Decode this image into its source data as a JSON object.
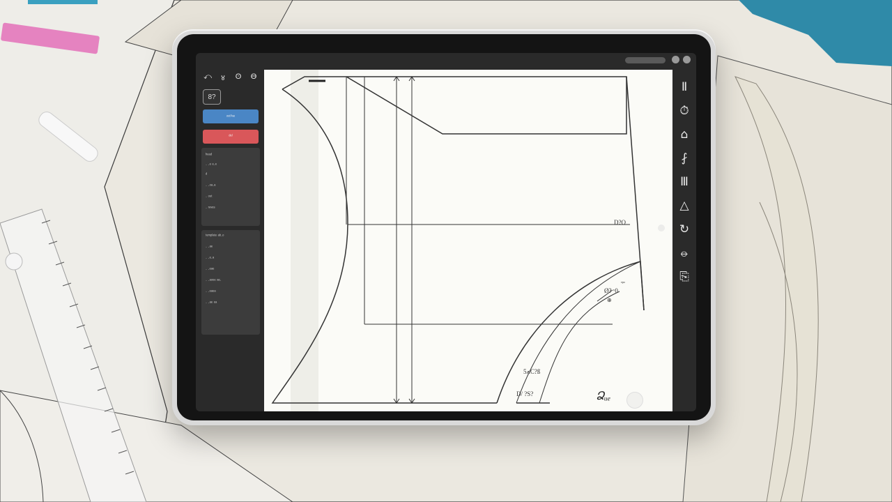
{
  "app": {
    "toolbar_icons": [
      "undo-icon",
      "brush-icon",
      "eraser-icon",
      "layers-icon"
    ],
    "toolbar_glyphs": [
      "⤺",
      "४",
      "ʘ",
      "Ɵ"
    ],
    "layer_badge": "8?",
    "blue_button_label": "ᵒᵘᵗˡⁱⁿᵉ",
    "red_button_label": "ᵈᵉˡ",
    "panel_top": {
      "lines": [
        "ʰᵉᵃᵈ",
        "· ·ᵉ ᵉ·ᵉ",
        "ᵈ",
        "· ·ᵒᵃ·ᵃ",
        "· ᵒᵘᵗ",
        "· ʳᵉᵛᵉˢ"
      ]
    },
    "panel_bottom": {
      "header": "ᵗᵉᵐᵖˡᵃᵗᵉ ᵃᵇ·ᵒ",
      "lines": [
        "· ·ᵃᵉ",
        "· ·ᵉ·ᵃ",
        "· ·ᵉᵃᵉ",
        "· ·ᵃᵒᵉᵉ ᵃᵉ·",
        "· ·ᵉᵃᵉᵃ",
        "· ·ᵃᵉ ᵉᵃ"
      ]
    }
  },
  "canvas": {
    "dim_labels": {
      "right_mid": "D?O",
      "arc_top_a": "ᵉᵖᵒ",
      "arc_top_b": "Ø? ᵛ0",
      "arc_top_c": "⊕",
      "arc_lower": "ߍ5C?ß",
      "arc_bottom": "D/ ?S?",
      "signature": "Ձᵤₑ"
    }
  },
  "right_toolbar": {
    "icons": [
      {
        "name": "pen-icon",
        "glyph": "Ⅱ"
      },
      {
        "name": "timer-icon",
        "glyph": "⏱"
      },
      {
        "name": "stamp-icon",
        "glyph": "⌂"
      },
      {
        "name": "ruler-icon",
        "glyph": "⨏"
      },
      {
        "name": "text-icon",
        "glyph": "Ⅲ"
      },
      {
        "name": "triangle-icon",
        "glyph": "△"
      },
      {
        "name": "curve-icon",
        "glyph": "↻"
      },
      {
        "name": "compass-icon",
        "glyph": "⦵"
      },
      {
        "name": "export-icon",
        "glyph": "⎘"
      }
    ]
  }
}
